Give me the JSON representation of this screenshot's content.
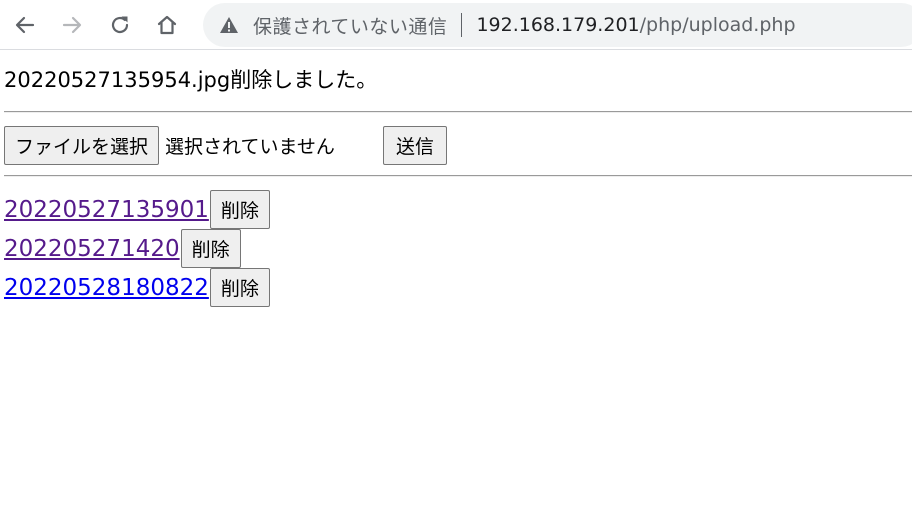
{
  "browser": {
    "security_text": "保護されていない通信",
    "url_host": "192.168.179.201",
    "url_path": "/php/upload.php"
  },
  "page": {
    "message": "20220527135954.jpg削除しました。",
    "form": {
      "file_button_label": "ファイルを選択",
      "file_status": "選択されていません",
      "submit_label": "送信"
    },
    "files": [
      {
        "name": "20220527135901",
        "delete_label": "削除",
        "visited": true
      },
      {
        "name": "202205271420",
        "delete_label": "削除",
        "visited": true
      },
      {
        "name": "20220528180822",
        "delete_label": "削除",
        "visited": false
      }
    ]
  },
  "colors": {
    "link": "#0000ee",
    "visited_link": "#551a8b",
    "omnibox_bg": "#f1f3f4"
  }
}
